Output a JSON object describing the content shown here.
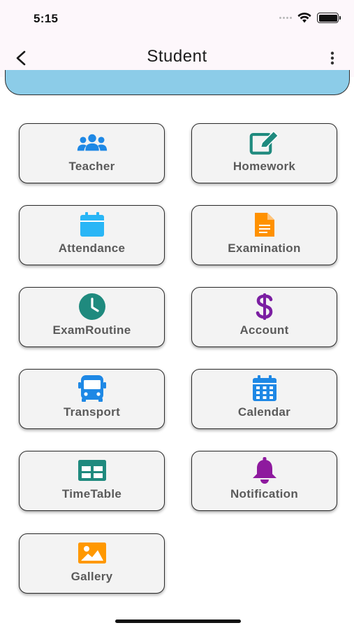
{
  "status": {
    "time": "5:15"
  },
  "appbar": {
    "title": "Student"
  },
  "tiles": [
    {
      "label": "Teacher",
      "icon": "teacher-group-icon",
      "color": "#1e88e5"
    },
    {
      "label": "Homework",
      "icon": "edit-square-icon",
      "color": "#1f8a7e"
    },
    {
      "label": "Attendance",
      "icon": "calendar-blank-icon",
      "color": "#29b6f6"
    },
    {
      "label": "Examination",
      "icon": "document-icon",
      "color": "#ff9100"
    },
    {
      "label": "ExamRoutine",
      "icon": "clock-icon",
      "color": "#1f8a7e"
    },
    {
      "label": "Account",
      "icon": "dollar-icon",
      "color": "#7b1fa2"
    },
    {
      "label": "Transport",
      "icon": "bus-icon",
      "color": "#1e88e5"
    },
    {
      "label": "Calendar",
      "icon": "calendar-grid-icon",
      "color": "#1e88e5"
    },
    {
      "label": "TimeTable",
      "icon": "table-icon",
      "color": "#1f8a7e"
    },
    {
      "label": "Notification",
      "icon": "bell-icon",
      "color": "#8e1a9e"
    },
    {
      "label": "Gallery",
      "icon": "image-icon",
      "color": "#ff9800"
    }
  ]
}
